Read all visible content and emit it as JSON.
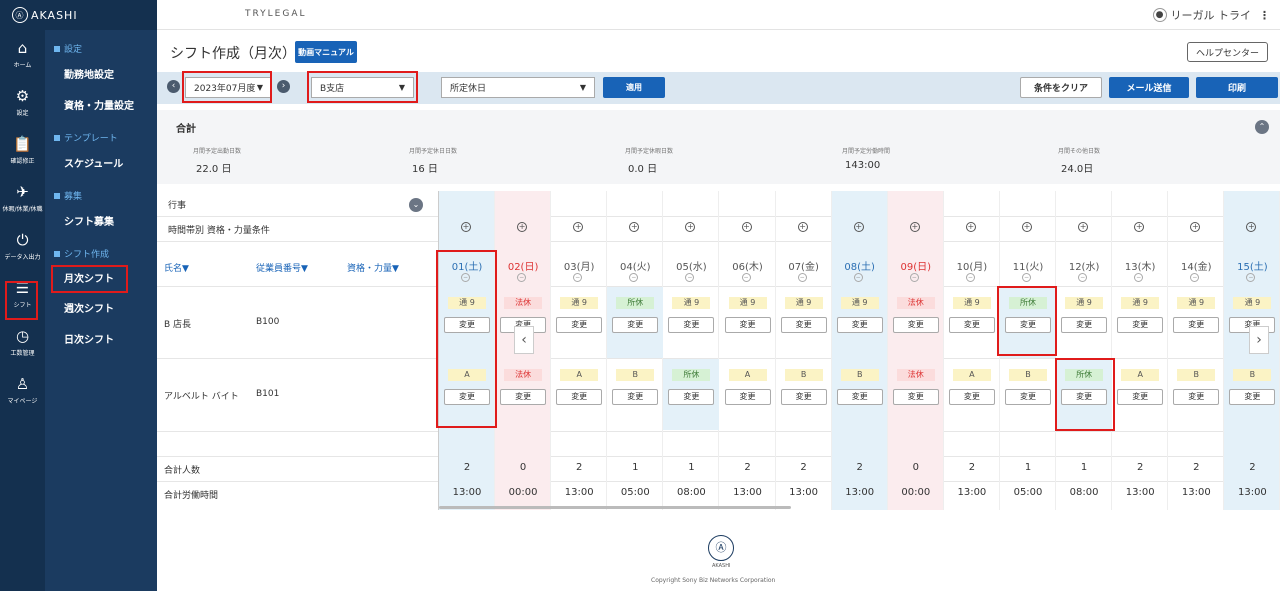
{
  "app": {
    "logo_text": "AKASHI",
    "brand": "TRYLEGAL",
    "user": "リーガル トライ",
    "logo_glyph": "Ⓐ"
  },
  "rail": [
    {
      "icon": "⌂",
      "label": "ホーム",
      "name": "home"
    },
    {
      "icon": "⚙",
      "label": "設定",
      "name": "settings"
    },
    {
      "icon": "📋",
      "label": "確認修正",
      "name": "confirm-edit"
    },
    {
      "icon": "✈",
      "label": "休暇/休業/休職",
      "name": "leave"
    },
    {
      "icon": "⏻",
      "label": "データ入出力",
      "name": "data-io"
    },
    {
      "icon": "☰",
      "label": "シフト",
      "name": "shift"
    },
    {
      "icon": "◷",
      "label": "工数管理",
      "name": "workload"
    },
    {
      "icon": "♙",
      "label": "マイページ",
      "name": "mypage"
    }
  ],
  "submenu": {
    "sections": [
      {
        "title": "設定",
        "items": [
          "勤務地設定",
          "資格・力量設定"
        ]
      },
      {
        "title": "テンプレート",
        "items": [
          "スケジュール"
        ]
      },
      {
        "title": "募集",
        "items": [
          "シフト募集"
        ]
      },
      {
        "title": "シフト作成",
        "items": [
          "月次シフト",
          "週次シフト",
          "日次シフト"
        ]
      }
    ]
  },
  "page": {
    "title": "シフト作成（月次）",
    "manual_btn": "動画マニュアル",
    "help_btn": "ヘルプセンター"
  },
  "filters": {
    "month": "2023年07月度",
    "branch": "B支店",
    "holiday": "所定休日",
    "apply": "適用",
    "clear": "条件をクリア",
    "mail": "メール送信",
    "print": "印刷"
  },
  "summary": {
    "title": "合計",
    "stats": [
      {
        "label": "月間予定出勤日数",
        "value": "22.0 日"
      },
      {
        "label": "月間予定休日日数",
        "value": "16 日"
      },
      {
        "label": "月間予定休暇日数",
        "value": "0.0 日"
      },
      {
        "label": "月間予定労働時間",
        "value": "143:00"
      },
      {
        "label": "月間その他日数",
        "value": "24.0日"
      }
    ]
  },
  "left": {
    "event_row": "行事",
    "time_row": "時間帯別 資格・力量条件",
    "headers": [
      "氏名▼",
      "従業員番号▼",
      "資格・力量▼"
    ],
    "employees": [
      {
        "name": "B 店長",
        "id": "B100"
      },
      {
        "name": "アルベルト バイト",
        "id": "B101"
      }
    ],
    "total_people": "合計人数",
    "total_hours": "合計労働時間"
  },
  "change_label": "変更",
  "plus_glyph": "+",
  "sub_glyph": "−",
  "nav": {
    "prev": "‹",
    "next": "›",
    "small_prev": "‹",
    "small_next": "›"
  },
  "days": [
    {
      "date": "01(土)",
      "type": "sat",
      "s1": "通 9",
      "s1c": "norm",
      "s2": "A",
      "s2c": "norm",
      "people": "2",
      "hours": "13:00"
    },
    {
      "date": "02(日)",
      "type": "sun",
      "s1": "法休",
      "s1c": "hol",
      "s2": "法休",
      "s2c": "hol",
      "people": "0",
      "hours": "00:00"
    },
    {
      "date": "03(月)",
      "type": "wk",
      "s1": "通 9",
      "s1c": "norm",
      "s2": "A",
      "s2c": "norm",
      "people": "2",
      "hours": "13:00"
    },
    {
      "date": "04(火)",
      "type": "wk",
      "s1": "所休",
      "s1c": "off",
      "s2": "B",
      "s2c": "norm",
      "people": "1",
      "hours": "05:00",
      "blue": [
        1
      ]
    },
    {
      "date": "05(水)",
      "type": "wk",
      "s1": "通 9",
      "s1c": "norm",
      "s2": "所休",
      "s2c": "off",
      "people": "1",
      "hours": "08:00",
      "blue": [
        2
      ]
    },
    {
      "date": "06(木)",
      "type": "wk",
      "s1": "通 9",
      "s1c": "norm",
      "s2": "A",
      "s2c": "norm",
      "people": "2",
      "hours": "13:00"
    },
    {
      "date": "07(金)",
      "type": "wk",
      "s1": "通 9",
      "s1c": "norm",
      "s2": "B",
      "s2c": "norm",
      "people": "2",
      "hours": "13:00"
    },
    {
      "date": "08(土)",
      "type": "sat",
      "s1": "通 9",
      "s1c": "norm",
      "s2": "B",
      "s2c": "norm",
      "people": "2",
      "hours": "13:00"
    },
    {
      "date": "09(日)",
      "type": "sun",
      "s1": "法休",
      "s1c": "hol",
      "s2": "法休",
      "s2c": "hol",
      "people": "0",
      "hours": "00:00"
    },
    {
      "date": "10(月)",
      "type": "wk",
      "s1": "通 9",
      "s1c": "norm",
      "s2": "A",
      "s2c": "norm",
      "people": "2",
      "hours": "13:00"
    },
    {
      "date": "11(火)",
      "type": "wk",
      "s1": "所休",
      "s1c": "off",
      "s2": "B",
      "s2c": "norm",
      "people": "1",
      "hours": "05:00",
      "blue": [
        1
      ]
    },
    {
      "date": "12(水)",
      "type": "wk",
      "s1": "通 9",
      "s1c": "norm",
      "s2": "所休",
      "s2c": "off",
      "people": "1",
      "hours": "08:00",
      "blue": [
        2
      ]
    },
    {
      "date": "13(木)",
      "type": "wk",
      "s1": "通 9",
      "s1c": "norm",
      "s2": "A",
      "s2c": "norm",
      "people": "2",
      "hours": "13:00"
    },
    {
      "date": "14(金)",
      "type": "wk",
      "s1": "通 9",
      "s1c": "norm",
      "s2": "B",
      "s2c": "norm",
      "people": "2",
      "hours": "13:00"
    },
    {
      "date": "15(土)",
      "type": "sat",
      "s1": "通 9",
      "s1c": "norm",
      "s2": "B",
      "s2c": "norm",
      "people": "2",
      "hours": "13:00"
    }
  ],
  "footer": {
    "brand": "AKASHI",
    "copyright": "Copyright Sony Biz Networks Corporation",
    "logo_glyph": "Ⓐ"
  }
}
